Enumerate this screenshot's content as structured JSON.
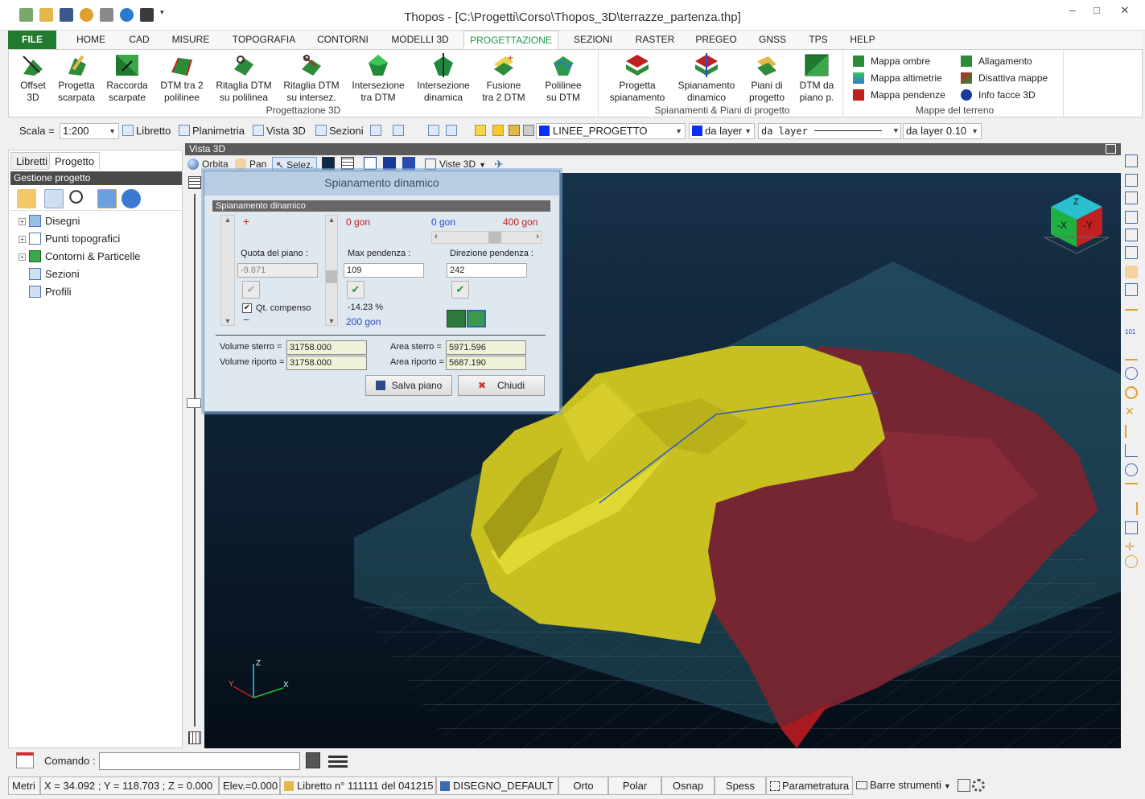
{
  "app": {
    "title": "Thopos - [C:\\Progetti\\Corso\\Thopos_3D\\terrazze_partenza.thp]",
    "window_controls": {
      "minimize": "–",
      "maximize": "□",
      "close": "✕"
    }
  },
  "ribbon": {
    "tabs": [
      "FILE",
      "HOME",
      "CAD",
      "MISURE",
      "TOPOGRAFIA",
      "CONTORNI",
      "MODELLI 3D",
      "PROGETTAZIONE",
      "SEZIONI",
      "RASTER",
      "PREGEO",
      "GNSS",
      "TPS",
      "HELP"
    ],
    "active_tab": "PROGETTAZIONE",
    "groups": {
      "progettazione3d": {
        "label": "Progettazione 3D",
        "buttons": [
          {
            "l1": "Offset",
            "l2": "3D",
            "icon": "offset-3d-icon"
          },
          {
            "l1": "Progetta",
            "l2": "scarpata",
            "icon": "progetta-scarpata-icon"
          },
          {
            "l1": "Raccorda",
            "l2": "scarpate",
            "icon": "raccorda-scarpate-icon"
          },
          {
            "l1": "DTM tra 2",
            "l2": "polilinee",
            "icon": "dtm-tra-2-polilinee-icon"
          },
          {
            "l1": "Ritaglia DTM",
            "l2": "su polilinea",
            "icon": "ritaglia-dtm-polilinea-icon"
          },
          {
            "l1": "Ritaglia DTM",
            "l2": "su intersez.",
            "icon": "ritaglia-dtm-intersez-icon"
          },
          {
            "l1": "Intersezione",
            "l2": "tra DTM",
            "icon": "intersezione-dtm-icon"
          },
          {
            "l1": "Intersezione",
            "l2": "dinamica",
            "icon": "intersezione-dinamica-icon"
          },
          {
            "l1": "Fusione",
            "l2": "tra 2 DTM",
            "icon": "fusione-dtm-icon"
          },
          {
            "l1": "Polilinee",
            "l2": "su DTM",
            "icon": "polilinee-dtm-icon"
          }
        ]
      },
      "spianamenti": {
        "label": "Spianamenti & Piani di progetto",
        "buttons": [
          {
            "l1": "Progetta",
            "l2": "spianamento",
            "icon": "progetta-spianamento-icon"
          },
          {
            "l1": "Spianamento",
            "l2": "dinamico",
            "icon": "spianamento-dinamico-icon"
          },
          {
            "l1": "Piani di",
            "l2": "progetto",
            "icon": "piani-progetto-icon"
          },
          {
            "l1": "DTM da",
            "l2": "piano p.",
            "icon": "dtm-da-piano-icon"
          }
        ]
      },
      "mappe": {
        "label": "Mappe del terreno",
        "items": [
          "Mappa ombre",
          "Mappa altimetrie",
          "Mappa pendenze",
          "Allagamento",
          "Disattiva mappe",
          "Info facce 3D"
        ]
      }
    }
  },
  "toolbar": {
    "scala_label": "Scala =",
    "scala_value": "1:200",
    "libretto": "Libretto",
    "planimetria": "Planimetria",
    "vista3d": "Vista 3D",
    "sezioni": "Sezioni",
    "layer": "LINEE_PROGETTO",
    "color": "da layer",
    "linetype": "da layer",
    "lineweight": "da layer 0.10",
    "layer_color": "#0a2ff5"
  },
  "left_panel": {
    "tabs": [
      "Libretti",
      "Progetto"
    ],
    "active_tab": "Progetto",
    "header": "Gestione progetto",
    "tree": [
      "Disegni",
      "Punti topografici",
      "Contorni & Particelle",
      "Sezioni",
      "Profili"
    ]
  },
  "view3d": {
    "title": "Vista 3D",
    "toolbar": {
      "orbita": "Orbita",
      "pan": "Pan",
      "selez": "Selez.",
      "viste3d": "Viste 3D"
    },
    "cube": {
      "top": "Z",
      "left": "-X",
      "right": "-Y"
    },
    "axes": {
      "x": "X",
      "y": "Y",
      "z": "Z"
    },
    "colors": {
      "background": "#0b1a2b",
      "cut": "#c8c020",
      "fill": "#7a2530",
      "plane": "#2d6a7a"
    }
  },
  "dialog": {
    "title": "Spianamento dinamico",
    "subtitle": "Spianamento dinamico",
    "gon_red_left": "0 gon",
    "gon_blue": "0 gon",
    "gon_red_right": "400 gon",
    "quota_label": "Quota del piano :",
    "quota_value": "-9.871",
    "max_pendenza_label": "Max pendenza :",
    "max_pendenza_value": "109",
    "direzione_label": "Direzione pendenza :",
    "direzione_value": "242",
    "percent": "-14.23 %",
    "gon_200": "200 gon",
    "qt_compenso": "Qt. compenso",
    "volume_sterro_label": "Volume sterro =",
    "volume_sterro": "31758.000",
    "volume_riporto_label": "Volume riporto =",
    "volume_riporto": "31758.000",
    "area_sterro_label": "Area sterro =",
    "area_sterro": "5971.596",
    "area_riporto_label": "Area riporto =",
    "area_riporto": "5687.190",
    "salva": "Salva piano",
    "chiudi": "Chiudi"
  },
  "command": {
    "label": "Comando :",
    "value": ""
  },
  "status": {
    "units": "Metri",
    "coords": "X = 34.092 ; Y = 118.703 ; Z = 0.000",
    "elev": "Elev.=0.000",
    "libretto": "Libretto n° 111111 del 041215",
    "disegno": "DISEGNO_DEFAULT",
    "orto": "Orto",
    "polar": "Polar",
    "osnap": "Osnap",
    "spess": "Spess",
    "parametratura": "Parametratura",
    "barre": "Barre strumenti"
  }
}
